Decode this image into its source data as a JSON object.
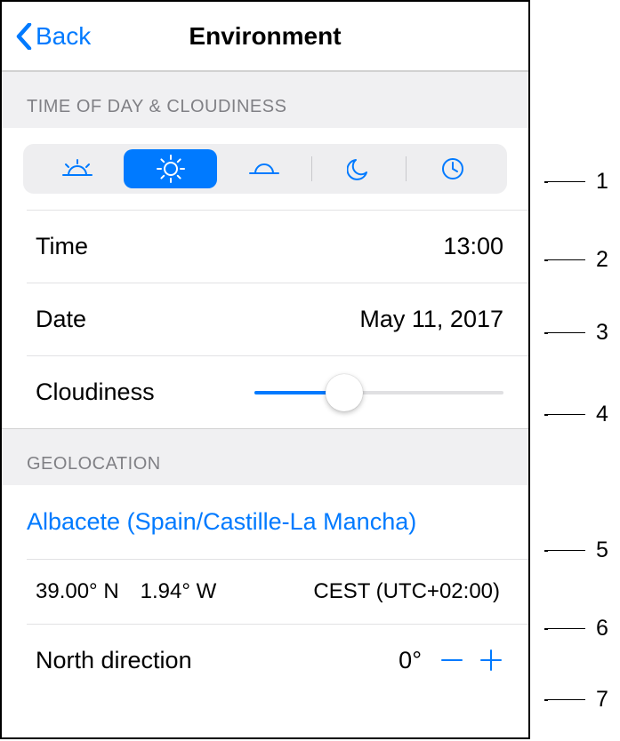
{
  "nav": {
    "back_label": "Back",
    "title": "Environment"
  },
  "sections": {
    "time_header": "TIME OF DAY & CLOUDINESS",
    "geo_header": "GEOLOCATION"
  },
  "segmented": {
    "items": [
      {
        "name": "sunrise"
      },
      {
        "name": "sun",
        "active": true
      },
      {
        "name": "sunset"
      },
      {
        "name": "moon"
      },
      {
        "name": "clock"
      }
    ]
  },
  "rows": {
    "time_label": "Time",
    "time_value": "13:00",
    "date_label": "Date",
    "date_value": "May 11, 2017",
    "cloudiness_label": "Cloudiness",
    "cloudiness_percent": 36,
    "location_value": "Albacete (Spain/Castille-La Mancha)",
    "lat": "39.00° N",
    "lon": "1.94° W",
    "tz": "CEST (UTC+02:00)",
    "north_label": "North direction",
    "north_value": "0°"
  },
  "callouts": {
    "c1": "1",
    "c2": "2",
    "c3": "3",
    "c4": "4",
    "c5": "5",
    "c6": "6",
    "c7": "7"
  }
}
